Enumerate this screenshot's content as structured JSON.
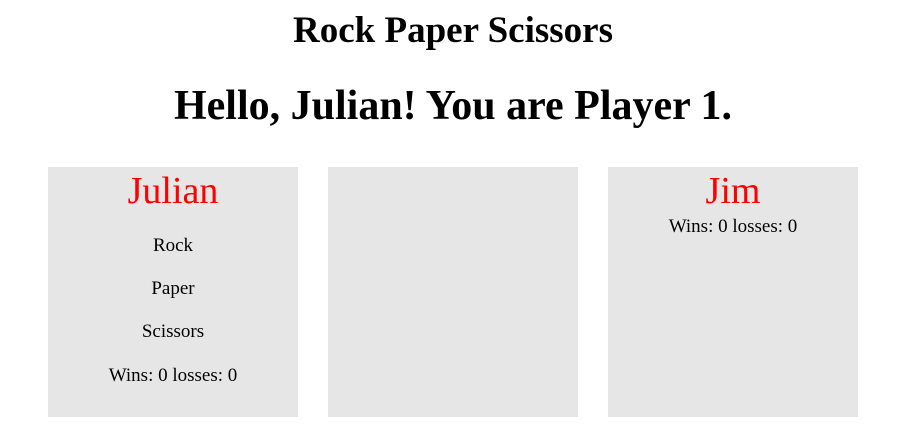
{
  "header": {
    "title": "Rock Paper Scissors",
    "greeting": "Hello, Julian! You are Player 1."
  },
  "player1": {
    "name": "Julian",
    "choices": [
      "Rock",
      "Paper",
      "Scissors"
    ],
    "record": "Wins: 0 losses: 0"
  },
  "result": {
    "text": ""
  },
  "player2": {
    "name": "Jim",
    "record": "Wins: 0 losses: 0"
  },
  "colors": {
    "panel_background": "#e6e6e6",
    "player_name": "#ff0000"
  }
}
